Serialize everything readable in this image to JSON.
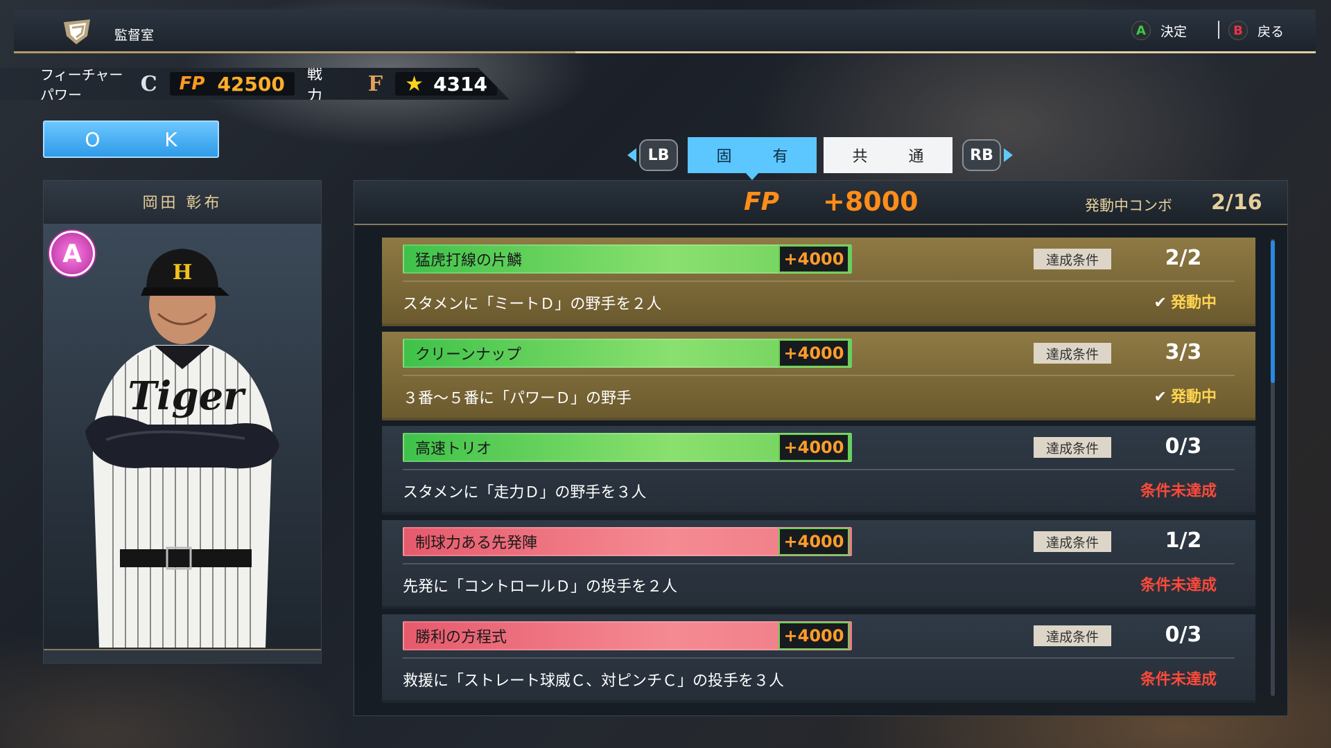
{
  "header": {
    "title": "監督室",
    "confirm_key": "A",
    "confirm_label": "決定",
    "back_key": "B",
    "back_label": "戻る",
    "confirm_color": "#3cc84a",
    "back_color": "#e8334a"
  },
  "status": {
    "future_power_label": "フィーチャーパワー",
    "future_power_rank": "C",
    "fp_label": "FP",
    "fp_value": "42500",
    "strength_label": "戦 力",
    "strength_rank": "F",
    "star_icon": "star-icon",
    "power_value": "4314"
  },
  "ok_button": {
    "label": "O K"
  },
  "manager": {
    "name": "岡田 彰布",
    "grade": "A"
  },
  "tabs": {
    "left_shoulder": "LB",
    "right_shoulder": "RB",
    "items": [
      {
        "label": "固 有",
        "active": true
      },
      {
        "label": "共 通",
        "active": false
      }
    ]
  },
  "panel": {
    "fp_label": "FP",
    "fp_bonus": "+8000",
    "active_combo_label": "発動中コンボ",
    "active_combo_count": "2/16",
    "combos": [
      {
        "name": "猛虎打線の片鱗",
        "bonus": "+4000",
        "cond_label": "達成条件",
        "progress": "2/2",
        "description": "スタメンに「ミートＤ」の野手を２人",
        "state": "発動中",
        "achieved": true,
        "bar_color": "green"
      },
      {
        "name": "クリーンナップ",
        "bonus": "+4000",
        "cond_label": "達成条件",
        "progress": "3/3",
        "description": "３番～５番に「パワーＤ」の野手",
        "state": "発動中",
        "achieved": true,
        "bar_color": "green"
      },
      {
        "name": "高速トリオ",
        "bonus": "+4000",
        "cond_label": "達成条件",
        "progress": "0/3",
        "description": "スタメンに「走力Ｄ」の野手を３人",
        "state": "条件未達成",
        "achieved": false,
        "bar_color": "green"
      },
      {
        "name": "制球力ある先発陣",
        "bonus": "+4000",
        "cond_label": "達成条件",
        "progress": "1/2",
        "description": "先発に「コントロールＤ」の投手を２人",
        "state": "条件未達成",
        "achieved": false,
        "bar_color": "red"
      },
      {
        "name": "勝利の方程式",
        "bonus": "+4000",
        "cond_label": "達成条件",
        "progress": "0/3",
        "description": "救援に「ストレート球威Ｃ、対ピンチＣ」の投手を３人",
        "state": "条件未達成",
        "achieved": false,
        "bar_color": "red"
      }
    ]
  }
}
